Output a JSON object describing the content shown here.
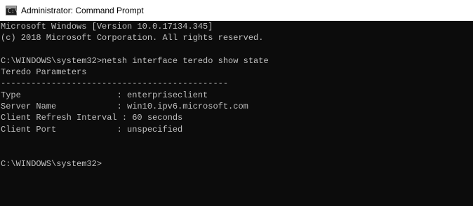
{
  "window": {
    "title": "Administrator: Command Prompt",
    "icon": "command-prompt-icon"
  },
  "console": {
    "lines": [
      "Microsoft Windows [Version 10.0.17134.345]",
      "(c) 2018 Microsoft Corporation. All rights reserved.",
      "",
      "C:\\WINDOWS\\system32>netsh interface teredo show state",
      "Teredo Parameters",
      "---------------------------------------------",
      "Type                   : enterpriseclient",
      "Server Name            : win10.ipv6.microsoft.com",
      "Client Refresh Interval : 60 seconds",
      "Client Port            : unspecified",
      "",
      "",
      "C:\\WINDOWS\\system32>"
    ]
  }
}
